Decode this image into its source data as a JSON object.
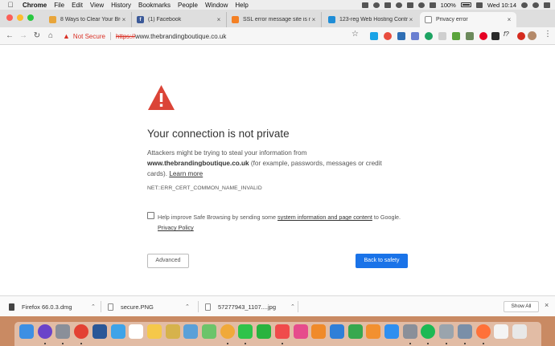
{
  "menubar": {
    "app": "Chrome",
    "items": [
      "File",
      "Edit",
      "View",
      "History",
      "Bookmarks",
      "People",
      "Window",
      "Help"
    ],
    "battery": "100%",
    "clock": "Wed 10:14"
  },
  "tabs": [
    {
      "label": "8 Ways to Clear Your Browse",
      "favicon_color": "#e8a53a"
    },
    {
      "label": "(1) Facebook",
      "favicon_color": "#3b5998",
      "favicon_text": "f"
    },
    {
      "label": "SSL error message site is n",
      "favicon_color": "#f48024"
    },
    {
      "label": "123-reg Web Hosting Contr",
      "favicon_color": "#1f8dd6"
    },
    {
      "label": "Privacy error",
      "favicon_color": "#888888"
    }
  ],
  "toolbar": {
    "not_secure": "Not Secure",
    "url_scheme": "https://",
    "url_host": "www.thebrandingboutique.co.uk",
    "ext_f_label": "f?",
    "ext_adblock": "ABP"
  },
  "interstitial": {
    "title": "Your connection is not private",
    "para_1": "Attackers might be trying to steal your information from",
    "para_host": "www.thebrandingboutique.co.uk",
    "para_2": " (for example, passwords, messages or credit cards).",
    "learn_more": "Learn more",
    "error_code": "NET::ERR_CERT_COMMON_NAME_INVALID",
    "sb_pre": "Help improve Safe Browsing by sending some ",
    "sb_link": "system information and page content",
    "sb_post": " to Google.",
    "privacy_policy": "Privacy Policy",
    "advanced": "Advanced",
    "back_to_safety": "Back to safety"
  },
  "downloads": [
    {
      "name": "Firefox 66.0.3.dmg"
    },
    {
      "name": "secure.PNG"
    },
    {
      "name": "57277943_1107....jpg"
    }
  ],
  "shelf": {
    "show_all": "Show All",
    "close": "×"
  },
  "colors": {
    "accent": "#1a73e8",
    "danger": "#d93025",
    "warning_icon": "#db4437"
  }
}
